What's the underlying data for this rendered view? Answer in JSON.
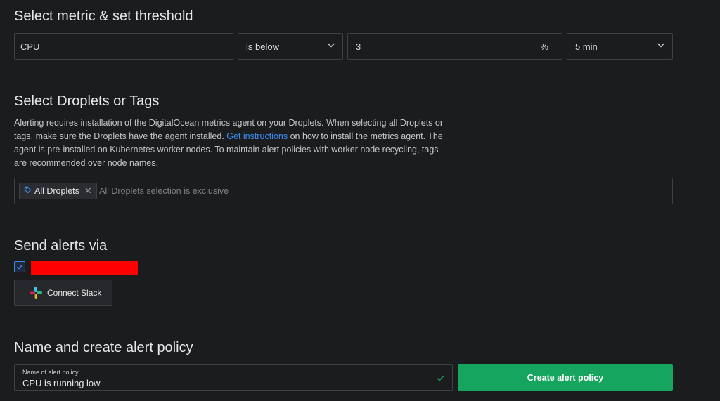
{
  "threshold": {
    "title": "Select metric & set threshold",
    "metric": "CPU",
    "comparator": "is below",
    "value": "3",
    "unit": "%",
    "window": "5 min"
  },
  "droplets": {
    "title": "Select Droplets or Tags",
    "desc_before": "Alerting requires installation of the DigitalOcean metrics agent on your Droplets. When selecting all Droplets or tags, make sure the Droplets have the agent installed. ",
    "desc_link": "Get instructions",
    "desc_after": " on how to install the metrics agent. The agent is pre-installed on Kubernetes worker nodes. To maintain alert policies with worker node recycling, tags are recommended over node names.",
    "tag_label": "All Droplets",
    "placeholder": "All Droplets selection is exclusive"
  },
  "alerts": {
    "title": "Send alerts via",
    "email_checked": true,
    "slack_label": "Connect Slack"
  },
  "policy": {
    "title": "Name and create alert policy",
    "name_label": "Name of alert policy",
    "name_value": "CPU is running low",
    "create_label": "Create alert policy"
  },
  "colors": {
    "accent": "#3b8cf2",
    "create_button": "#15a55e",
    "redaction": "#ff0000"
  }
}
